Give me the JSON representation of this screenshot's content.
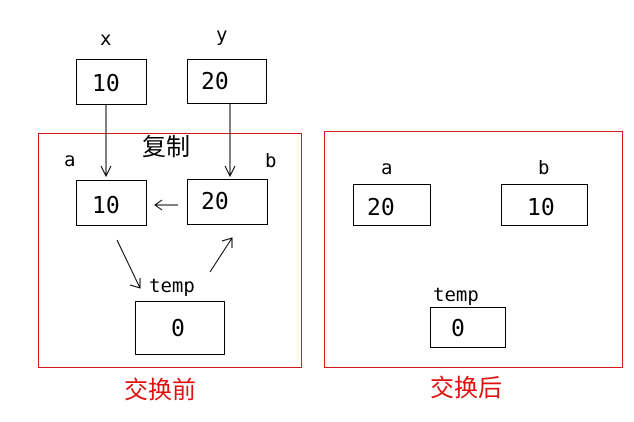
{
  "top": {
    "x": {
      "label": "x",
      "value": "10"
    },
    "y": {
      "label": "y",
      "value": "20"
    }
  },
  "before": {
    "copy_label": "复制",
    "a": {
      "label": "a",
      "value": "10"
    },
    "b": {
      "label": "b",
      "value": "20"
    },
    "temp": {
      "label": "temp",
      "value": "0"
    },
    "caption": "交换前"
  },
  "after": {
    "a": {
      "label": "a",
      "value": "20"
    },
    "b": {
      "label": "b",
      "value": "10"
    },
    "temp": {
      "label": "temp",
      "value": "0"
    },
    "caption": "交换后"
  },
  "colors": {
    "frame": "#d11a1a",
    "caption": "#e01010",
    "line": "#000000"
  }
}
